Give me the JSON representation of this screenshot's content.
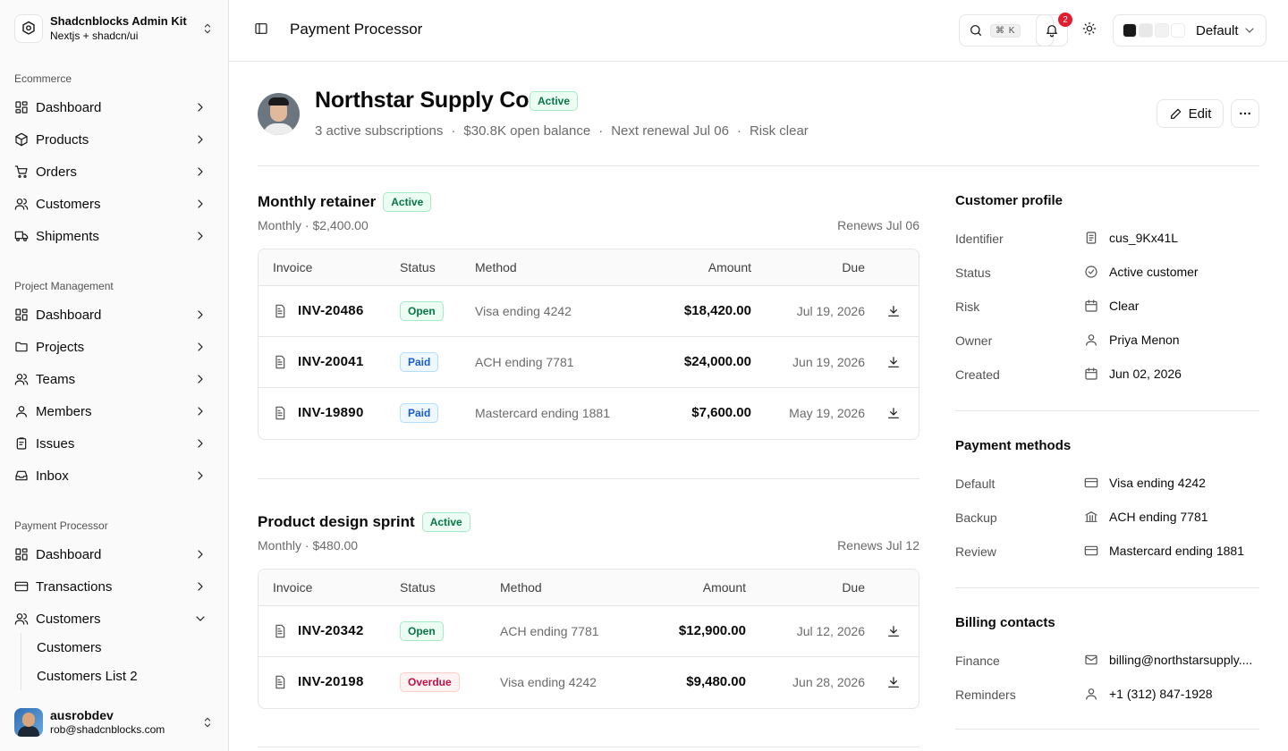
{
  "sidebar": {
    "brand": {
      "title": "Shadcnblocks Admin Kit",
      "subtitle": "Nextjs + shadcn/ui"
    },
    "groups": [
      {
        "label": "Ecommerce",
        "items": [
          "Dashboard",
          "Products",
          "Orders",
          "Customers",
          "Shipments"
        ]
      },
      {
        "label": "Project Management",
        "items": [
          "Dashboard",
          "Projects",
          "Teams",
          "Members",
          "Issues",
          "Inbox"
        ]
      },
      {
        "label": "Payment Processor",
        "items": [
          "Dashboard",
          "Transactions",
          "Customers"
        ]
      }
    ],
    "sub_items": [
      "Customers",
      "Customers List 2"
    ],
    "user": {
      "name": "ausrobdev",
      "email": "rob@shadcnblocks.com"
    }
  },
  "header": {
    "title": "Payment Processor",
    "search_kbd": "⌘ K",
    "notifications": "2",
    "theme": "Default",
    "swatches": [
      "#1a1a1a",
      "#e8e8e8",
      "#f2f2f2",
      "#ffffff"
    ]
  },
  "customer": {
    "name": "Northstar Supply Co.",
    "status": "Active",
    "meta": [
      "3 active subscriptions",
      "$30.8K open balance",
      "Next renewal Jul 06",
      "Risk clear"
    ],
    "edit_label": "Edit"
  },
  "table_headers": [
    "Invoice",
    "Status",
    "Method",
    "Amount",
    "Due"
  ],
  "subscriptions": [
    {
      "title": "Monthly retainer",
      "status": "Active",
      "meta": "Monthly · $2,400.00",
      "renews": "Renews Jul 06",
      "rows": [
        {
          "invoice": "INV-20486",
          "status": "Open",
          "method": "Visa ending 4242",
          "amount": "$18,420.00",
          "due": "Jul 19, 2026"
        },
        {
          "invoice": "INV-20041",
          "status": "Paid",
          "method": "ACH ending 7781",
          "amount": "$24,000.00",
          "due": "Jun 19, 2026"
        },
        {
          "invoice": "INV-19890",
          "status": "Paid",
          "method": "Mastercard ending 1881",
          "amount": "$7,600.00",
          "due": "May 19, 2026"
        }
      ]
    },
    {
      "title": "Product design sprint",
      "status": "Active",
      "meta": "Monthly · $480.00",
      "renews": "Renews Jul 12",
      "rows": [
        {
          "invoice": "INV-20342",
          "status": "Open",
          "method": "ACH ending 7781",
          "amount": "$12,900.00",
          "due": "Jul 12, 2026"
        },
        {
          "invoice": "INV-20198",
          "status": "Overdue",
          "method": "Visa ending 4242",
          "amount": "$9,480.00",
          "due": "Jun 28, 2026"
        }
      ]
    }
  ],
  "profile": {
    "title": "Customer profile",
    "fields": [
      {
        "label": "Identifier",
        "value": "cus_9Kx41L",
        "icon": "document-icon"
      },
      {
        "label": "Status",
        "value": "Active customer",
        "icon": "check-circle-icon"
      },
      {
        "label": "Risk",
        "value": "Clear",
        "icon": "calendar-icon"
      },
      {
        "label": "Owner",
        "value": "Priya Menon",
        "icon": "user-icon"
      },
      {
        "label": "Created",
        "value": "Jun 02, 2026",
        "icon": "calendar-icon"
      }
    ]
  },
  "payment_methods": {
    "title": "Payment methods",
    "fields": [
      {
        "label": "Default",
        "value": "Visa ending 4242",
        "icon": "card-icon"
      },
      {
        "label": "Backup",
        "value": "ACH ending 7781",
        "icon": "bank-icon"
      },
      {
        "label": "Review",
        "value": "Mastercard ending 1881",
        "icon": "card-icon"
      }
    ]
  },
  "billing_contacts": {
    "title": "Billing contacts",
    "fields": [
      {
        "label": "Finance",
        "value": "billing@northstarsupply....",
        "icon": "mail-icon"
      },
      {
        "label": "Reminders",
        "value": "+1 (312) 847-1928",
        "icon": "user-icon"
      }
    ]
  }
}
